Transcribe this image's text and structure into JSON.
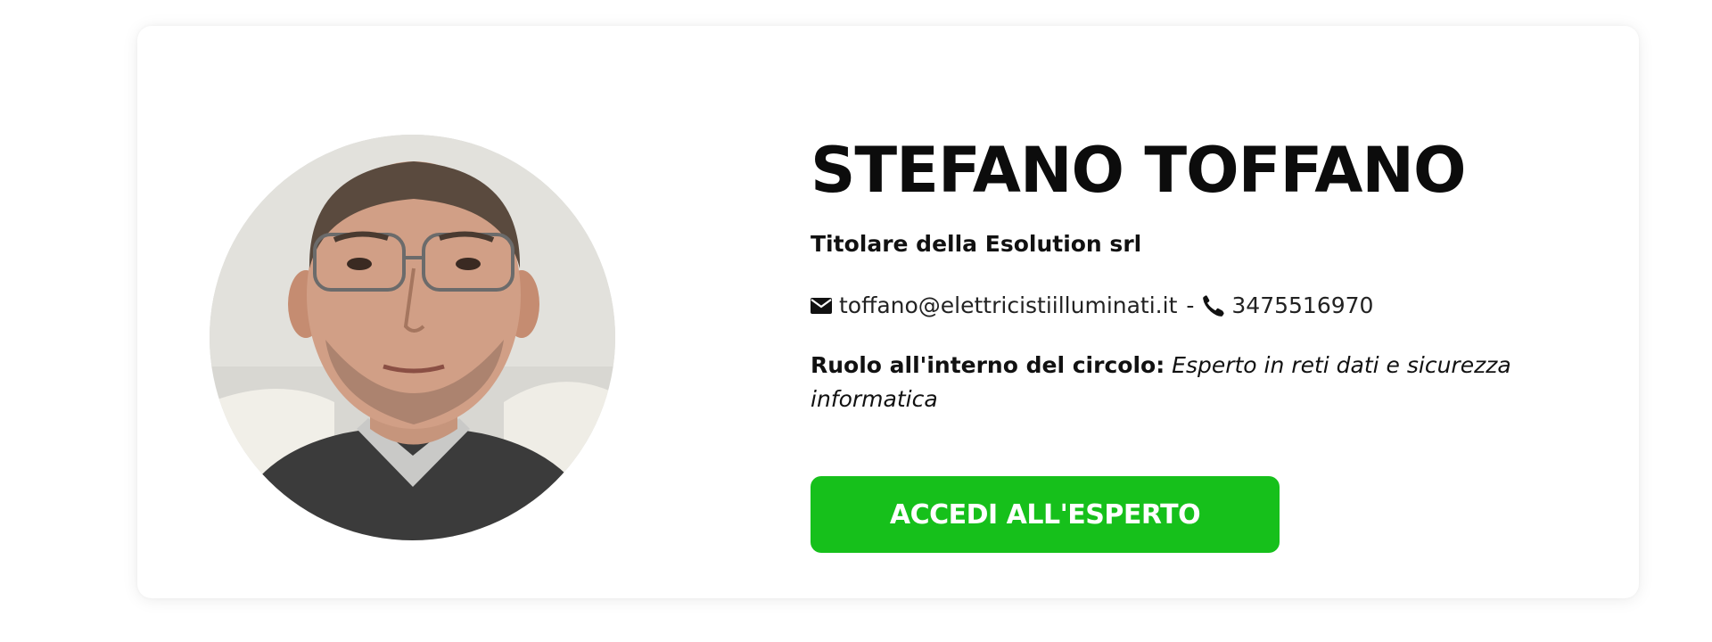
{
  "profile": {
    "name": "STEFANO TOFFANO",
    "title": "Titolare della Esolution srl",
    "email": "toffano@elettricistiilluminati.it",
    "separator": "-",
    "phone": "3475516970",
    "role_label": "Ruolo all'interno del circolo:",
    "role_value": "Esperto in reti dati e sicurezza informatica",
    "cta_label": "ACCEDI ALL'ESPERTO",
    "icons": {
      "email": "envelope-icon",
      "phone": "phone-icon"
    }
  },
  "colors": {
    "cta_background": "#16c01b",
    "text": "#111111",
    "card_background": "#ffffff"
  }
}
